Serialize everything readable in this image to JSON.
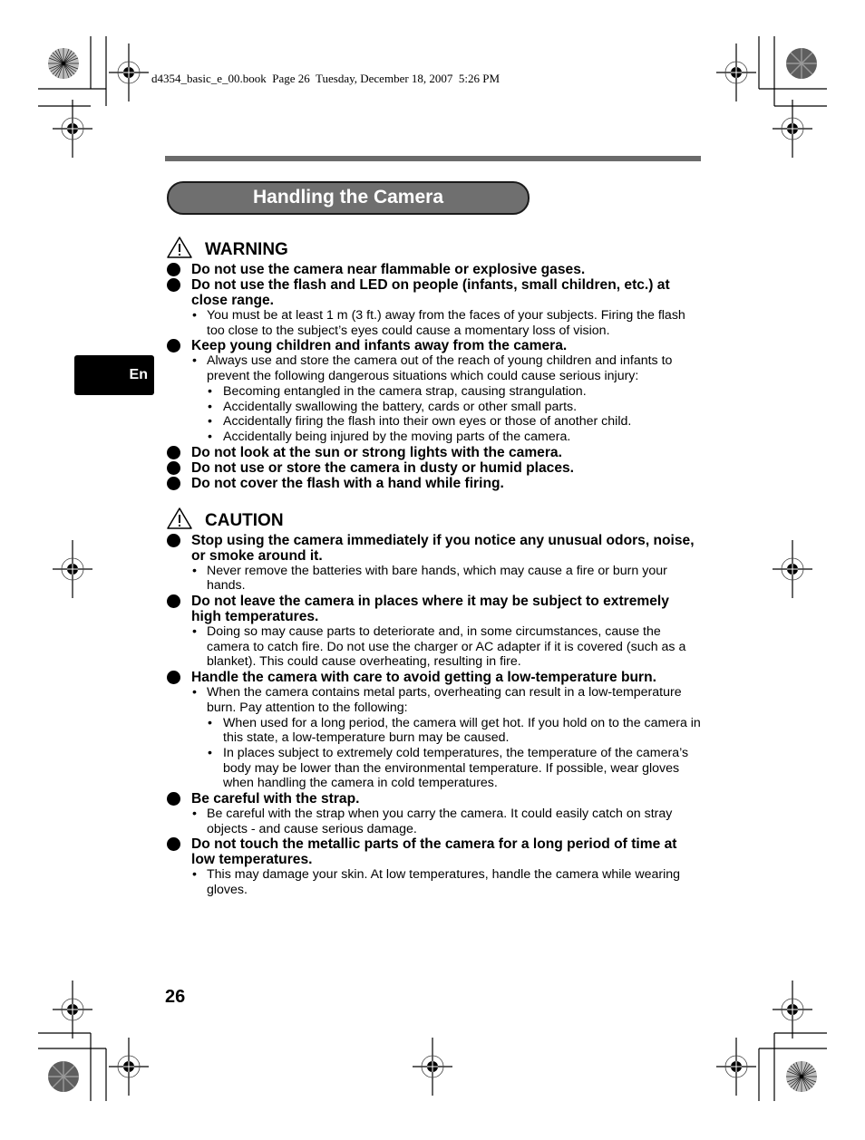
{
  "header": {
    "file_info": "d4354_basic_e_00.book  Page 26  Tuesday, December 18, 2007  5:26 PM"
  },
  "title": "Handling the Camera",
  "language_tab": "En",
  "colors": {
    "title_fill": "#6f6f6f",
    "rule": "#6b6b6b",
    "tab": "#000000"
  },
  "sections": [
    {
      "heading": "WARNING",
      "icon": "warning-triangle-icon",
      "items": [
        {
          "text": "Do not use the camera near flammable or explosive gases.",
          "bullets": []
        },
        {
          "text": "Do not use the flash and LED on people (infants, small children, etc.) at close range.",
          "bullets": [
            {
              "text": "You must be at least 1 m (3 ft.) away from the faces of your subjects. Firing the flash too close to the subject’s eyes could cause a momentary loss of vision.",
              "subbullets": []
            }
          ]
        },
        {
          "text": "Keep young children and infants away from the camera.",
          "bullets": [
            {
              "text": "Always use and store the camera out of the reach of young children and infants to prevent the following dangerous situations which could cause serious injury:",
              "subbullets": [
                "Becoming entangled in the camera strap, causing strangulation.",
                "Accidentally swallowing the battery, cards or other small parts.",
                "Accidentally firing the flash into their own eyes or those of another child.",
                "Accidentally being injured by the moving parts of the camera."
              ]
            }
          ]
        },
        {
          "text": "Do not look at the sun or strong lights with the camera.",
          "bullets": []
        },
        {
          "text": "Do not use or store the camera in dusty or humid places.",
          "bullets": []
        },
        {
          "text": "Do not cover the flash with a hand while firing.",
          "bullets": []
        }
      ]
    },
    {
      "heading": "CAUTION",
      "icon": "caution-triangle-icon",
      "items": [
        {
          "text": "Stop using the camera immediately if you notice any unusual odors, noise, or smoke around it.",
          "bullets": [
            {
              "text": "Never remove the batteries with bare hands, which may cause a fire or burn your hands.",
              "subbullets": []
            }
          ]
        },
        {
          "text": "Do not leave the camera in places where it may be subject to extremely high temperatures.",
          "bullets": [
            {
              "text": "Doing so may cause parts to deteriorate and, in some circumstances, cause the camera to catch fire. Do not use the charger or AC adapter if it is covered (such as a blanket). This could cause overheating, resulting in fire.",
              "subbullets": []
            }
          ]
        },
        {
          "text": "Handle the camera with care to avoid getting a low-temperature burn.",
          "bullets": [
            {
              "text": "When the camera contains metal parts, overheating can result in a low-temperature burn. Pay attention to the following:",
              "subbullets": [
                "When used for a long period, the camera will get hot. If you hold on to the camera in this state, a low-temperature burn may be caused.",
                "In places subject to extremely cold temperatures, the temperature of the camera’s body may be lower than the environmental temperature. If possible, wear gloves when handling the camera in cold temperatures."
              ]
            }
          ]
        },
        {
          "text": "Be careful with the strap.",
          "bullets": [
            {
              "text": "Be careful with the strap when you carry the camera. It could easily catch on stray objects - and cause serious damage.",
              "subbullets": []
            }
          ]
        },
        {
          "text": "Do not touch the metallic parts of the camera for a long period of time at low temperatures.",
          "bullets": [
            {
              "text": "This may damage your skin. At low temperatures, handle the camera while wearing gloves.",
              "subbullets": []
            }
          ]
        }
      ]
    }
  ],
  "page_number": "26"
}
